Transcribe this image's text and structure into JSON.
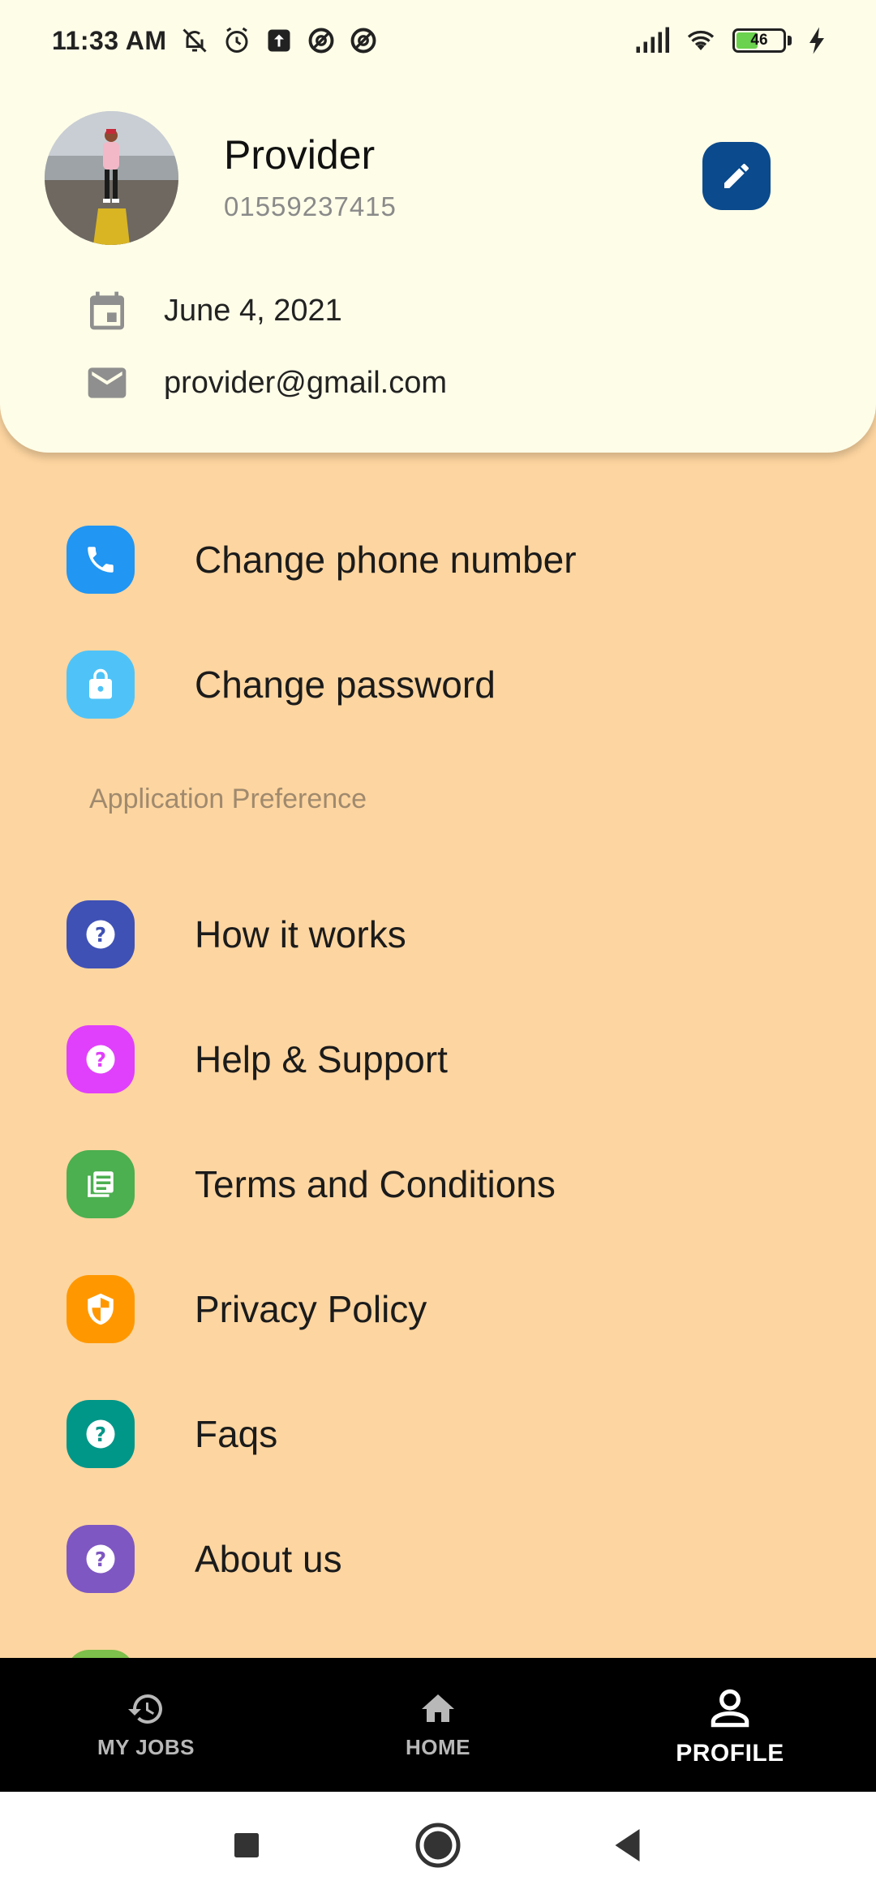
{
  "status_bar": {
    "time": "11:33 AM",
    "battery_level": "46",
    "left_icons": [
      "mute-icon",
      "alarm-icon",
      "upload-icon",
      "app-icon",
      "app-icon"
    ],
    "right_icons": [
      "signal-icon",
      "wifi-icon",
      "battery-icon",
      "charging-icon"
    ]
  },
  "profile": {
    "name": "Provider",
    "phone": "01559237415",
    "date": "June 4, 2021",
    "email": "provider@gmail.com"
  },
  "menu": {
    "account_items": [
      {
        "label": "Change phone number",
        "icon": "phone-icon",
        "color": "#2196f3"
      },
      {
        "label": "Change password",
        "icon": "lock-icon",
        "color": "#4fc3f7"
      }
    ],
    "section_header": "Application Preference",
    "preference_items": [
      {
        "label": "How it works",
        "icon": "help-icon",
        "color": "#3f51b5"
      },
      {
        "label": "Help & Support",
        "icon": "help-icon",
        "color": "#e040fb"
      },
      {
        "label": "Terms and Conditions",
        "icon": "document-icon",
        "color": "#4caf50"
      },
      {
        "label": "Privacy Policy",
        "icon": "shield-icon",
        "color": "#ff9800"
      },
      {
        "label": "Faqs",
        "icon": "help-icon",
        "color": "#009688"
      },
      {
        "label": "About us",
        "icon": "help-icon",
        "color": "#7e57c2"
      }
    ]
  },
  "bottom_nav": {
    "items": [
      {
        "label": "MY JOBS",
        "icon": "history-icon"
      },
      {
        "label": "HOME",
        "icon": "home-icon"
      },
      {
        "label": "PROFILE",
        "icon": "person-icon",
        "active": true
      }
    ]
  },
  "colors": {
    "background": "#fdd5a0",
    "card": "#fefde8",
    "edit_button": "#0b4a8c",
    "nav_background": "#000000"
  }
}
